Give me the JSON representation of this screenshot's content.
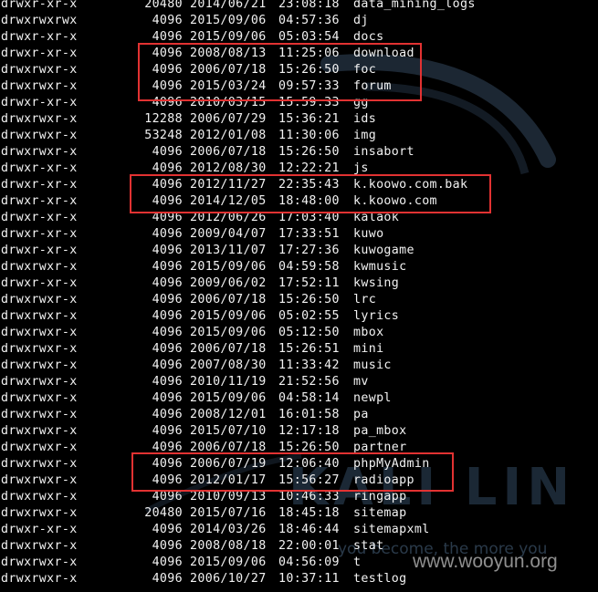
{
  "watermark": {
    "brand": "KALI LIN",
    "motto": "you become, the more you",
    "site": "www.wooyun.org"
  },
  "listing": [
    {
      "perm": "drwxr-xr-x",
      "size": "20480",
      "date": "2014/06/21",
      "time": "23:08:18",
      "name": "data_mining_logs"
    },
    {
      "perm": "drwxrwxrwx",
      "size": "4096",
      "date": "2015/09/06",
      "time": "04:57:36",
      "name": "dj"
    },
    {
      "perm": "drwxr-xr-x",
      "size": "4096",
      "date": "2015/09/06",
      "time": "05:03:54",
      "name": "docs"
    },
    {
      "perm": "drwxr-xr-x",
      "size": "4096",
      "date": "2008/08/13",
      "time": "11:25:06",
      "name": "download"
    },
    {
      "perm": "drwxrwxr-x",
      "size": "4096",
      "date": "2006/07/18",
      "time": "15:26:50",
      "name": "foc"
    },
    {
      "perm": "drwxrwxr-x",
      "size": "4096",
      "date": "2015/03/24",
      "time": "09:57:33",
      "name": "forum"
    },
    {
      "perm": "drwxr-xr-x",
      "size": "4096",
      "date": "2010/03/15",
      "time": "15:59:33",
      "name": "gg"
    },
    {
      "perm": "drwxrwxr-x",
      "size": "12288",
      "date": "2006/07/29",
      "time": "15:36:21",
      "name": "ids"
    },
    {
      "perm": "drwxrwxr-x",
      "size": "53248",
      "date": "2012/01/08",
      "time": "11:30:06",
      "name": "img"
    },
    {
      "perm": "drwxrwxr-x",
      "size": "4096",
      "date": "2006/07/18",
      "time": "15:26:50",
      "name": "insabort"
    },
    {
      "perm": "drwxr-xr-x",
      "size": "4096",
      "date": "2012/08/30",
      "time": "12:22:21",
      "name": "js"
    },
    {
      "perm": "drwxr-xr-x",
      "size": "4096",
      "date": "2012/11/27",
      "time": "22:35:43",
      "name": "k.koowo.com.bak"
    },
    {
      "perm": "drwxr-xr-x",
      "size": "4096",
      "date": "2014/12/05",
      "time": "18:48:00",
      "name": "k.koowo.com"
    },
    {
      "perm": "drwxr-xr-x",
      "size": "4096",
      "date": "2012/06/26",
      "time": "17:03:40",
      "name": "kalaok"
    },
    {
      "perm": "drwxr-xr-x",
      "size": "4096",
      "date": "2009/04/07",
      "time": "17:33:51",
      "name": "kuwo"
    },
    {
      "perm": "drwxr-xr-x",
      "size": "4096",
      "date": "2013/11/07",
      "time": "17:27:36",
      "name": "kuwogame"
    },
    {
      "perm": "drwxrwxr-x",
      "size": "4096",
      "date": "2015/09/06",
      "time": "04:59:58",
      "name": "kwmusic"
    },
    {
      "perm": "drwxr-xr-x",
      "size": "4096",
      "date": "2009/06/02",
      "time": "17:52:11",
      "name": "kwsing"
    },
    {
      "perm": "drwxrwxr-x",
      "size": "4096",
      "date": "2006/07/18",
      "time": "15:26:50",
      "name": "lrc"
    },
    {
      "perm": "drwxrwxr-x",
      "size": "4096",
      "date": "2015/09/06",
      "time": "05:02:55",
      "name": "lyrics"
    },
    {
      "perm": "drwxrwxr-x",
      "size": "4096",
      "date": "2015/09/06",
      "time": "05:12:50",
      "name": "mbox"
    },
    {
      "perm": "drwxrwxr-x",
      "size": "4096",
      "date": "2006/07/18",
      "time": "15:26:51",
      "name": "mini"
    },
    {
      "perm": "drwxrwxr-x",
      "size": "4096",
      "date": "2007/08/30",
      "time": "11:33:42",
      "name": "music"
    },
    {
      "perm": "drwxrwxr-x",
      "size": "4096",
      "date": "2010/11/19",
      "time": "21:52:56",
      "name": "mv"
    },
    {
      "perm": "drwxrwxr-x",
      "size": "4096",
      "date": "2015/09/06",
      "time": "04:58:14",
      "name": "newpl"
    },
    {
      "perm": "drwxrwxr-x",
      "size": "4096",
      "date": "2008/12/01",
      "time": "16:01:58",
      "name": "pa"
    },
    {
      "perm": "drwxrwxr-x",
      "size": "4096",
      "date": "2015/07/10",
      "time": "12:17:18",
      "name": "pa_mbox"
    },
    {
      "perm": "drwxrwxr-x",
      "size": "4096",
      "date": "2006/07/18",
      "time": "15:26:50",
      "name": "partner"
    },
    {
      "perm": "drwxrwxr-x",
      "size": "4096",
      "date": "2006/07/19",
      "time": "12:06:40",
      "name": "phpMyAdmin"
    },
    {
      "perm": "drwxrwxr-x",
      "size": "4096",
      "date": "2012/01/17",
      "time": "15:56:27",
      "name": "radioapp"
    },
    {
      "perm": "drwxrwxr-x",
      "size": "4096",
      "date": "2010/09/13",
      "time": "10:46:33",
      "name": "ringapp"
    },
    {
      "perm": "drwxrwxr-x",
      "size": "20480",
      "date": "2015/07/16",
      "time": "18:45:18",
      "name": "sitemap"
    },
    {
      "perm": "drwxr-xr-x",
      "size": "4096",
      "date": "2014/03/26",
      "time": "18:46:44",
      "name": "sitemapxml"
    },
    {
      "perm": "drwxrwxr-x",
      "size": "4096",
      "date": "2008/08/18",
      "time": "22:00:01",
      "name": "stat"
    },
    {
      "perm": "drwxrwxr-x",
      "size": "4096",
      "date": "2015/09/06",
      "time": "04:56:09",
      "name": "t"
    },
    {
      "perm": "drwxrwxr-x",
      "size": "4096",
      "date": "2006/10/27",
      "time": "10:37:11",
      "name": "testlog"
    }
  ],
  "highlight_color": "#e23232"
}
